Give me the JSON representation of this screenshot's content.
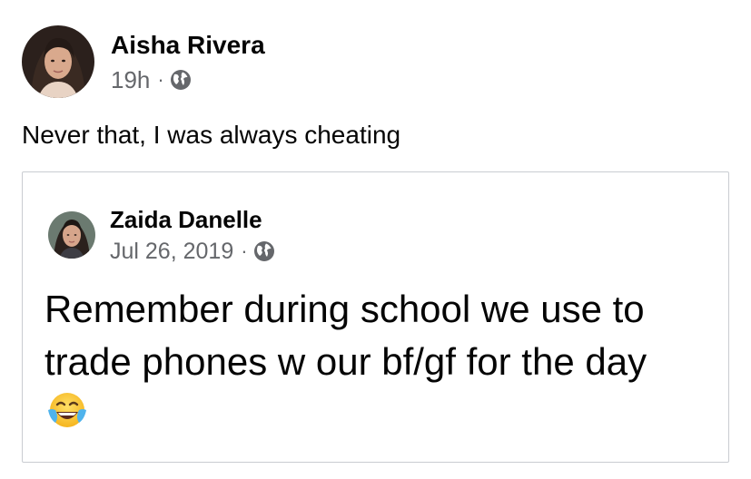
{
  "post": {
    "author_name": "Aisha Rivera",
    "timestamp": "19h",
    "separator": "·",
    "audience_icon": "globe-icon",
    "text": "Never that, I was always cheating"
  },
  "shared_post": {
    "author_name": "Zaida Danelle",
    "timestamp": "Jul 26, 2019",
    "separator": "·",
    "audience_icon": "globe-icon",
    "text": "Remember during school we use to trade phones w our bf/gf for the day",
    "emoji": "face-with-tears-of-joy"
  },
  "colors": {
    "primary_text": "#050505",
    "secondary_text": "#65676b",
    "card_border": "#c9ccd1"
  }
}
